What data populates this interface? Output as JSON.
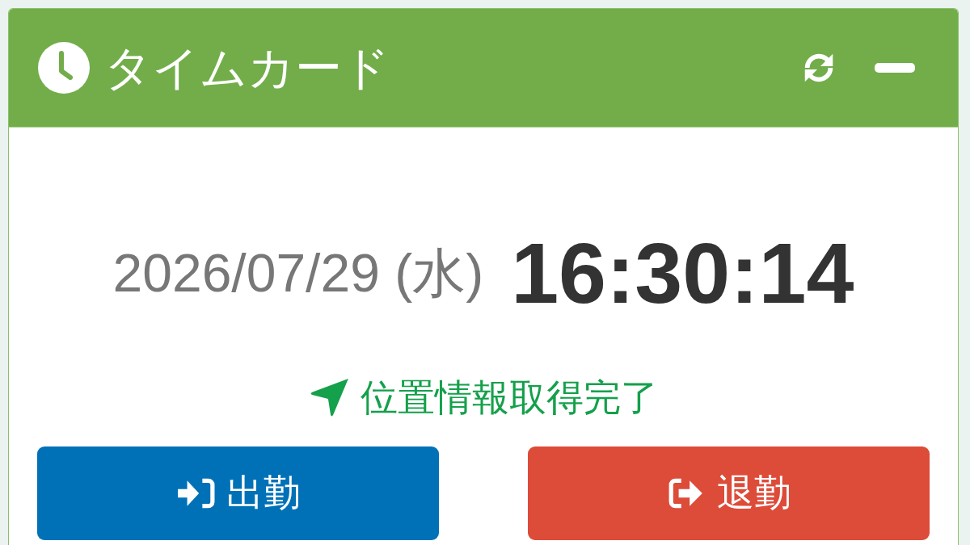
{
  "panel": {
    "title": "タイムカード"
  },
  "clock": {
    "date": "2026/07/29 (水)",
    "time": "16:30:14"
  },
  "location_status": "位置情報取得完了",
  "buttons": [
    {
      "label": "出勤",
      "kind": "clock_in"
    },
    {
      "label": "退勤",
      "kind": "clock_out"
    }
  ]
}
